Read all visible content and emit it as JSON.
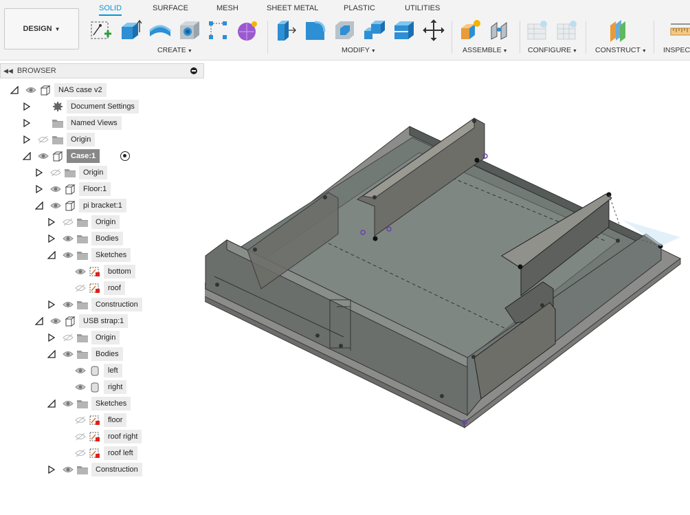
{
  "toolbar": {
    "workspace_button": "DESIGN",
    "tabs": [
      "SOLID",
      "SURFACE",
      "MESH",
      "SHEET METAL",
      "PLASTIC",
      "UTILITIES"
    ],
    "active_tab": "SOLID",
    "groups": [
      "CREATE",
      "MODIFY",
      "ASSEMBLE",
      "CONFIGURE",
      "CONSTRUCT",
      "INSPECT"
    ],
    "accent_color": "#0696d7"
  },
  "browser": {
    "title": "BROWSER",
    "items": [
      {
        "label": "NAS case v2",
        "icon": "component-icon"
      },
      {
        "label": "Document Settings",
        "icon": "gear-icon"
      },
      {
        "label": "Named Views",
        "icon": "folder-icon"
      },
      {
        "label": "Origin",
        "icon": "folder-icon"
      },
      {
        "label": "Case:1",
        "icon": "component-icon"
      },
      {
        "label": "Origin",
        "icon": "folder-icon"
      },
      {
        "label": "Floor:1",
        "icon": "component-icon"
      },
      {
        "label": "pi bracket:1",
        "icon": "component-icon"
      },
      {
        "label": "Origin",
        "icon": "folder-icon"
      },
      {
        "label": "Bodies",
        "icon": "folder-icon"
      },
      {
        "label": "Sketches",
        "icon": "folder-icon"
      },
      {
        "label": "bottom",
        "icon": "sketch-icon"
      },
      {
        "label": "roof",
        "icon": "sketch-icon"
      },
      {
        "label": "Construction",
        "icon": "folder-icon"
      },
      {
        "label": "USB strap:1",
        "icon": "component-icon"
      },
      {
        "label": "Origin",
        "icon": "folder-icon"
      },
      {
        "label": "Bodies",
        "icon": "folder-icon"
      },
      {
        "label": "left",
        "icon": "body-icon"
      },
      {
        "label": "right",
        "icon": "body-icon"
      },
      {
        "label": "Sketches",
        "icon": "folder-icon"
      },
      {
        "label": "floor",
        "icon": "sketch-icon"
      },
      {
        "label": "roof right",
        "icon": "sketch-icon"
      },
      {
        "label": "roof left",
        "icon": "sketch-icon"
      },
      {
        "label": "Construction",
        "icon": "folder-icon"
      }
    ]
  }
}
